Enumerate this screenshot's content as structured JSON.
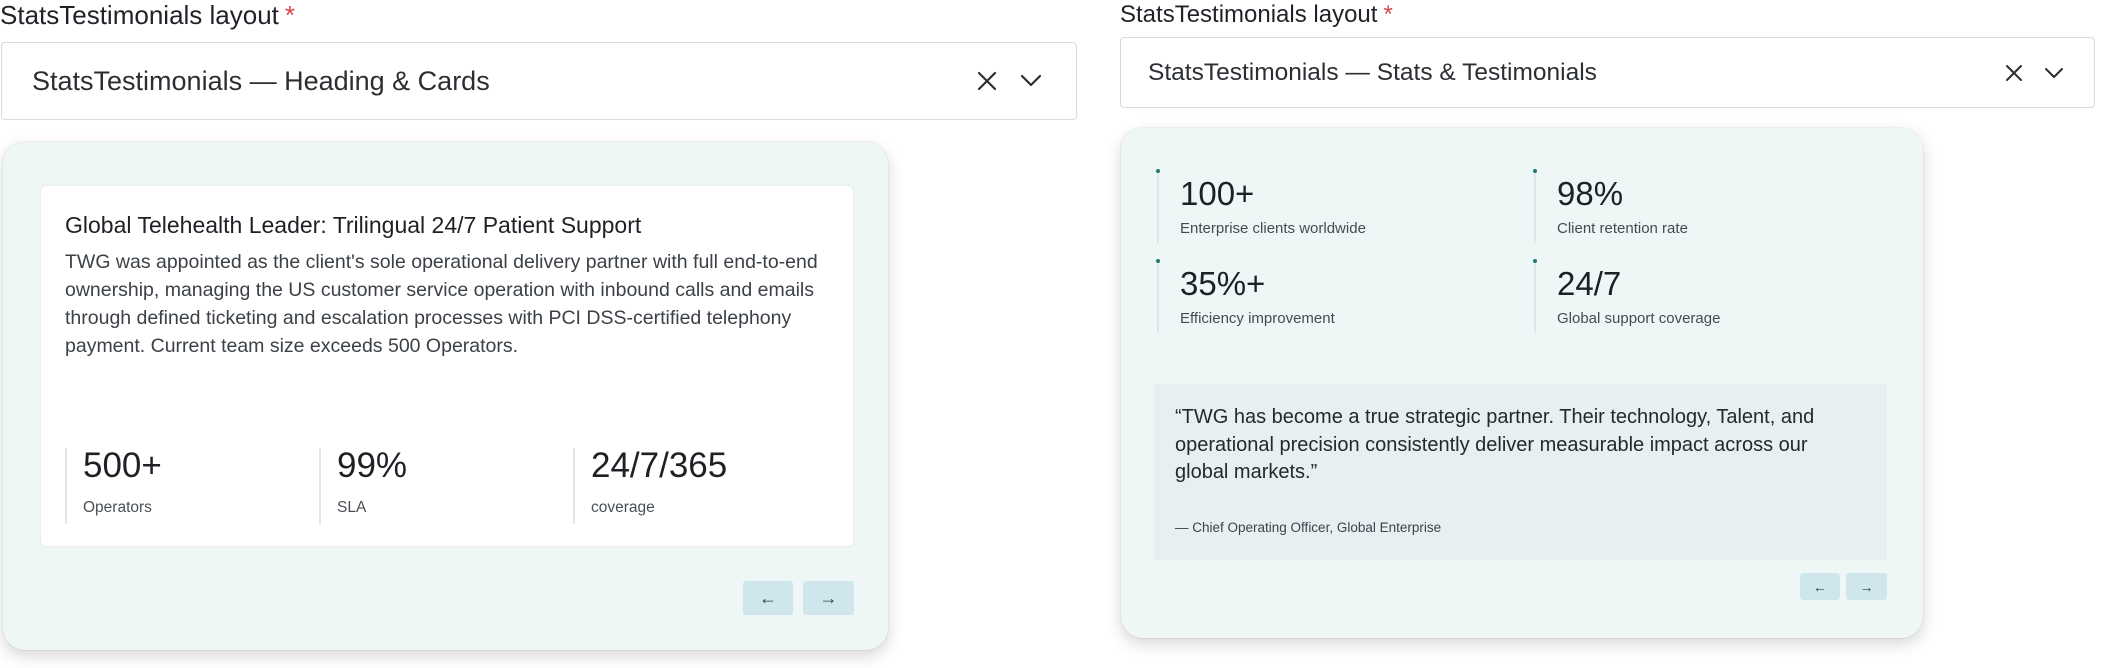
{
  "left": {
    "field_label": "StatsTestimonials layout",
    "required_mark": "*",
    "select_value": "StatsTestimonials — Heading & Cards",
    "case": {
      "title": "Global Telehealth Leader: Trilingual 24/7 Patient Support",
      "body": "TWG was appointed as the client's sole operational delivery partner with full end-to-end ownership, managing the US customer service operation with inbound calls and emails through defined ticketing and escalation processes with PCI DSS-certified telephony payment. Current team size exceeds 500 Operators.",
      "stats": [
        {
          "value": "500+",
          "label": "Operators"
        },
        {
          "value": "99%",
          "label": "SLA"
        },
        {
          "value": "24/7/365",
          "label": "coverage"
        }
      ]
    },
    "prev_label": "←",
    "next_label": "→"
  },
  "right": {
    "field_label": "StatsTestimonials layout",
    "required_mark": "*",
    "select_value": "StatsTestimonials — Stats & Testimonials",
    "stats": [
      {
        "value": "100+",
        "label": "Enterprise clients worldwide"
      },
      {
        "value": "98%",
        "label": "Client retention rate"
      },
      {
        "value": "35%+",
        "label": "Efficiency improvement"
      },
      {
        "value": "24/7",
        "label": "Global support coverage"
      }
    ],
    "quote": "“TWG has become a true strategic partner. Their technology, Talent, and operational precision consistently deliver measurable impact across our global markets.”",
    "author": "— Chief Operating Officer, Global Enterprise",
    "prev_label": "←",
    "next_label": "→"
  },
  "icons": {
    "clear": "close-icon",
    "dropdown": "chevron-down-icon"
  }
}
